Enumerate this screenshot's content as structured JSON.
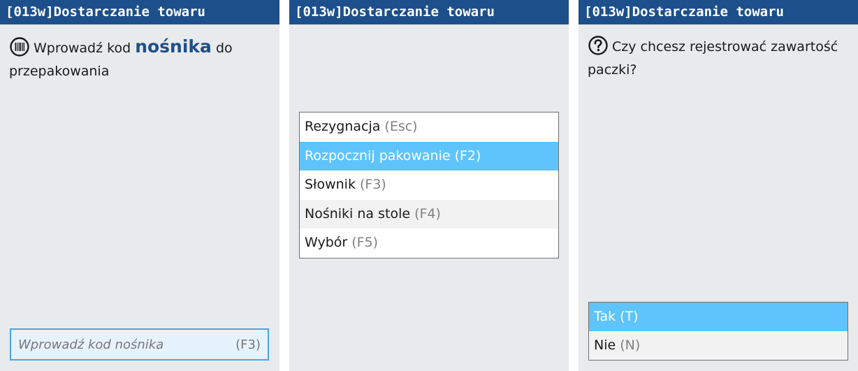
{
  "screens": [
    {
      "title": "[013w]Dostarczanie towaru",
      "prompt_before": "Wprowadź kod",
      "prompt_emphasis": "nośnika",
      "prompt_after": "do przepakowania",
      "prompt_icon": "barcode-icon",
      "input": {
        "placeholder": "Wprowadź kod nośnika",
        "value": "",
        "shortcut": "(F3)"
      }
    },
    {
      "title": "[013w]Dostarczanie towaru",
      "menu": [
        {
          "label": "Rezygnacja",
          "key": "(Esc)",
          "state": "normal"
        },
        {
          "label": "Rozpocznij pakowanie",
          "key": "(F2)",
          "state": "selected"
        },
        {
          "label": "Słownik",
          "key": "(F3)",
          "state": "normal"
        },
        {
          "label": "Nośniki na stole",
          "key": "(F4)",
          "state": "alt"
        },
        {
          "label": "Wybór",
          "key": "(F5)",
          "state": "normal"
        }
      ]
    },
    {
      "title": "[013w]Dostarczanie towaru",
      "question": "Czy chcesz rejestrować zawartość paczki?",
      "question_icon": "question-icon",
      "answers": [
        {
          "label": "Tak",
          "key": "(T)",
          "state": "selected"
        },
        {
          "label": "Nie",
          "key": "(N)",
          "state": "normal"
        }
      ]
    }
  ],
  "colors": {
    "titlebar": "#1d4f8b",
    "background": "#e9eaeb",
    "selected": "#5ec4fb",
    "input_border": "#4aa3e8",
    "emphasis": "#1d4f8b"
  }
}
